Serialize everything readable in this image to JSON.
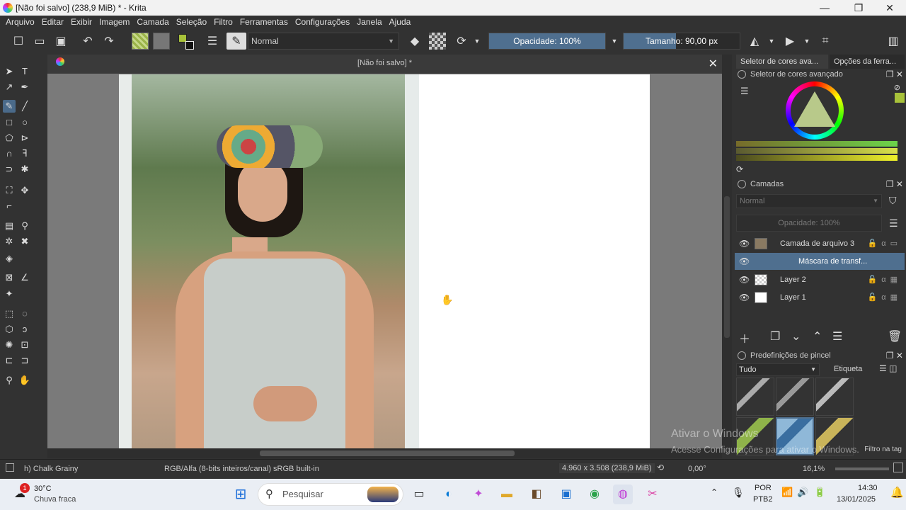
{
  "window": {
    "title": "[Não foi salvo]  (238,9 MiB)  * - Krita",
    "minimize": "—",
    "maximize": "❐",
    "close": "✕"
  },
  "menu": [
    "Arquivo",
    "Editar",
    "Exibir",
    "Imagem",
    "Camada",
    "Seleção",
    "Filtro",
    "Ferramentas",
    "Configurações",
    "Janela",
    "Ajuda"
  ],
  "toolbar": {
    "blend_mode": "Normal",
    "opacity_label": "Opacidade: 100%",
    "opacity_value": 1.0,
    "size_label": "Tamanho: 90,00 px",
    "size_fill": 0.45
  },
  "document": {
    "tab_title": "[Não foi salvo]  *",
    "close": "✕"
  },
  "dock": {
    "tabs": [
      "Seletor de cores ava...",
      "Opções da ferra..."
    ],
    "color_selector_title": "Seletor de cores avançado",
    "layers_title": "Camadas",
    "layers_blend": "Normal",
    "layers_opacity": "Opacidade:  100%",
    "layers": [
      {
        "name": "Camada de arquivo 3",
        "selected": false
      },
      {
        "name": "Máscara de transf...",
        "selected": true
      },
      {
        "name": "Layer 2",
        "selected": false
      },
      {
        "name": "Layer 1",
        "selected": false
      }
    ],
    "brush_title": "Predefinições de pincel",
    "brush_filter": "Tudo",
    "brush_tag": "Etiqueta",
    "brush_filter_tag": "Filtro na tag"
  },
  "status": {
    "brush_name": "h) Chalk Grainy",
    "color_space": "RGB/Alfa (8-bits inteiros/canal)  sRGB built-in",
    "image_size": "4.960 x 3.508 (238,9 MiB)",
    "rotation": "0,00°",
    "zoom": "16,1%"
  },
  "watermark": {
    "line1": "Ativar o Windows",
    "line2": "Acesse Configurações para ativar o Windows."
  },
  "taskbar": {
    "weather_temp": "30°C",
    "weather_desc": "Chuva fraca",
    "weather_badge": "1",
    "search_placeholder": "Pesquisar",
    "lang": "POR",
    "layout": "PTB2",
    "time": "14:30",
    "date": "13/01/2025"
  },
  "colors": {
    "accent": "#4f6f8f",
    "fg_color": "#a8c23a"
  }
}
